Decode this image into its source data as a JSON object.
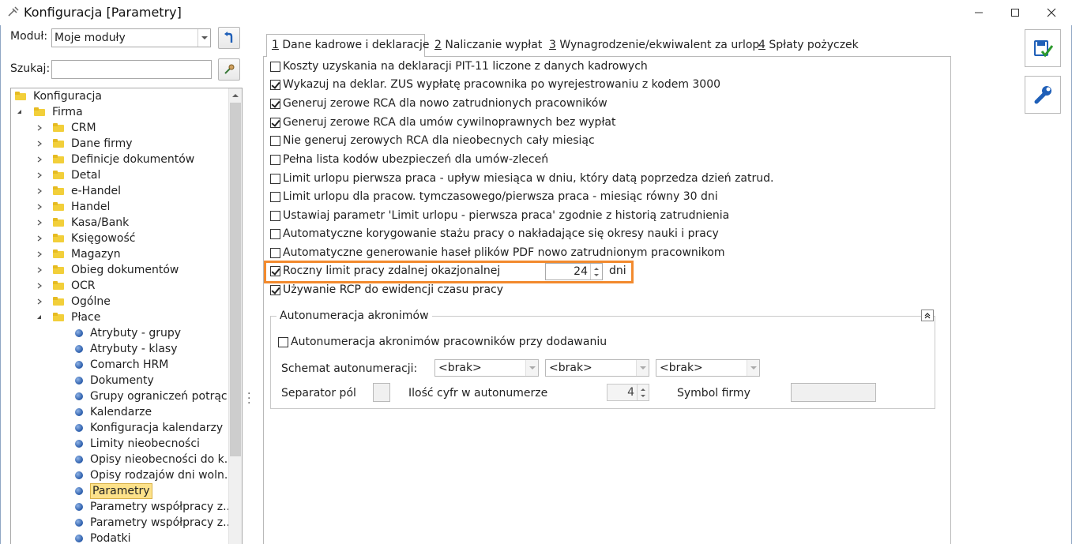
{
  "window": {
    "title": "Konfiguracja [Parametry]"
  },
  "left": {
    "module_label": "Moduł:",
    "module_value": "Moje moduły",
    "search_label": "Szukaj:",
    "search_value": ""
  },
  "tree": {
    "root": "Konfiguracja",
    "firma": "Firma",
    "firma_children": [
      "CRM",
      "Dane firmy",
      "Definicje dokumentów",
      "Detal",
      "e-Handel",
      "Handel",
      "Kasa/Bank",
      "Księgowość",
      "Magazyn",
      "Obieg dokumentów",
      "OCR",
      "Ogólne"
    ],
    "place": "Płace",
    "place_children": [
      "Atrybuty - grupy",
      "Atrybuty - klasy",
      "Comarch HRM",
      "Dokumenty",
      "Grupy ograniczeń potrąc...",
      "Kalendarze",
      "Konfiguracja kalendarzy",
      "Limity nieobecności",
      "Opisy nieobecności do k...",
      "Opisy rodzajów dni woln...",
      "Parametry",
      "Parametry współpracy z...",
      "Parametry współpracy z...",
      "Podatki"
    ],
    "selected": "Parametry"
  },
  "tabs": [
    {
      "num": "1",
      "label": " Dane kadrowe i deklaracje"
    },
    {
      "num": "2",
      "label": " Naliczanie wypłat"
    },
    {
      "num": "3",
      "label": " Wynagrodzenie/ekwiwalent za urlop"
    },
    {
      "num": "4",
      "label": " Spłaty pożyczek"
    }
  ],
  "options": [
    {
      "label": "Koszty uzyskania na deklaracji PIT-11 liczone z danych kadrowych",
      "checked": false
    },
    {
      "label": "Wykazuj na deklar. ZUS wypłatę pracownika po wyrejestrowaniu z kodem 3000",
      "checked": true
    },
    {
      "label": "Generuj zerowe RCA dla nowo zatrudnionych pracowników",
      "checked": true
    },
    {
      "label": "Generuj zerowe RCA dla umów cywilnoprawnych bez wypłat",
      "checked": true
    },
    {
      "label": "Nie generuj zerowych RCA dla nieobecnych cały miesiąc",
      "checked": false
    },
    {
      "label": "Pełna lista kodów ubezpieczeń dla umów-zleceń",
      "checked": false
    },
    {
      "label": "Limit urlopu pierwsza praca - upływ miesiąca w dniu, który datą poprzedza dzień zatrud.",
      "checked": false
    },
    {
      "label": "Limit urlopu dla pracow. tymczasowego/pierwsza praca - miesiąc równy 30 dni",
      "checked": false
    },
    {
      "label": "Ustawiaj parametr 'Limit urlopu - pierwsza praca' zgodnie z historią zatrudnienia",
      "checked": false
    },
    {
      "label": "Automatyczne korygowanie stażu pracy o nakładające się okresy nauki i pracy",
      "checked": false
    },
    {
      "label": "Automatyczne generowanie haseł plików PDF nowo zatrudnionym pracownikom",
      "checked": false
    },
    {
      "label": "Roczny limit pracy zdalnej okazjonalnej",
      "checked": true
    },
    {
      "label": "Używanie RCP do ewidencji czasu pracy",
      "checked": true
    }
  ],
  "remote_limit": {
    "value": "24",
    "unit": "dni"
  },
  "autonum": {
    "title": "Autonumeracja akronimów",
    "checkbox_label": "Autonumeracja akronimów pracowników przy dodawaniu",
    "checkbox_checked": false,
    "schema_label": "Schemat autonumeracji:",
    "schema_values": [
      "<brak>",
      "<brak>",
      "<brak>"
    ],
    "separator_label": "Separator pól",
    "digits_label": "Ilość cyfr w autonumerze",
    "digits_value": "4",
    "symbol_label": "Symbol firmy",
    "symbol_value": ""
  }
}
